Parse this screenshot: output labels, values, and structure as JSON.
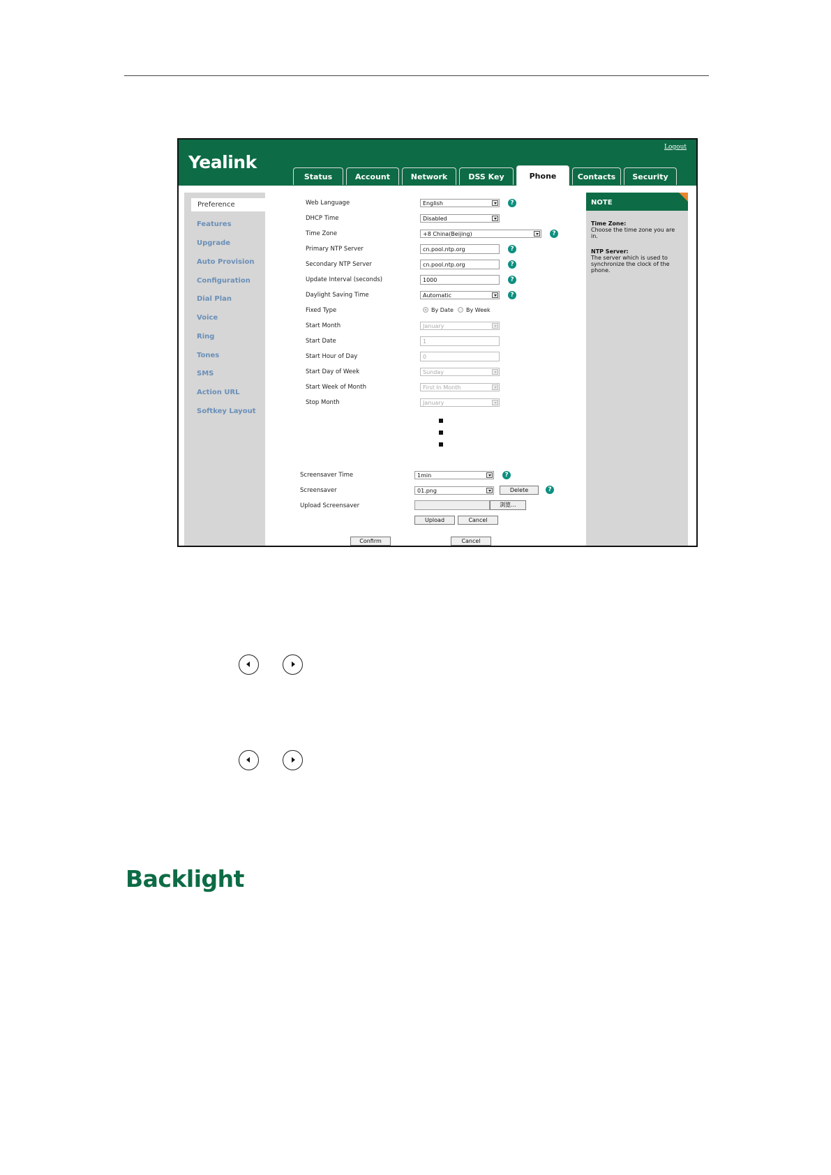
{
  "window": {
    "logo": "Yealink",
    "logout": "Logout"
  },
  "tabs": [
    {
      "label": "Status"
    },
    {
      "label": "Account"
    },
    {
      "label": "Network"
    },
    {
      "label": "DSS Key"
    },
    {
      "label": "Phone",
      "active": true
    },
    {
      "label": "Contacts"
    },
    {
      "label": "Security"
    }
  ],
  "sidebar": {
    "items": [
      {
        "label": "Preference",
        "active": true
      },
      {
        "label": "Features"
      },
      {
        "label": "Upgrade"
      },
      {
        "label": "Auto Provision"
      },
      {
        "label": "Configuration"
      },
      {
        "label": "Dial Plan"
      },
      {
        "label": "Voice"
      },
      {
        "label": "Ring"
      },
      {
        "label": "Tones"
      },
      {
        "label": "SMS"
      },
      {
        "label": "Action URL"
      },
      {
        "label": "Softkey Layout"
      }
    ]
  },
  "form": {
    "web_language": {
      "label": "Web Language",
      "value": "English"
    },
    "dhcp_time": {
      "label": "DHCP Time",
      "value": "Disabled"
    },
    "time_zone": {
      "label": "Time Zone",
      "value": "+8 China(Beijing)"
    },
    "primary_ntp": {
      "label": "Primary NTP Server",
      "value": "cn.pool.ntp.org"
    },
    "secondary_ntp": {
      "label": "Secondary NTP Server",
      "value": "cn.pool.ntp.org"
    },
    "update_interval": {
      "label": "Update Interval (seconds)",
      "value": "1000"
    },
    "daylight_saving": {
      "label": "Daylight Saving Time",
      "value": "Automatic"
    },
    "fixed_type": {
      "label": "Fixed Type",
      "option_by_date": "By Date",
      "option_by_week": "By Week"
    },
    "start_month": {
      "label": "Start Month",
      "value": "January"
    },
    "start_date": {
      "label": "Start Date",
      "value": "1"
    },
    "start_hour": {
      "label": "Start Hour of Day",
      "value": "0"
    },
    "start_day_of_week": {
      "label": "Start Day of Week",
      "value": "Sunday"
    },
    "start_week_of_month": {
      "label": "Start Week of Month",
      "value": "First In Month"
    },
    "stop_month": {
      "label": "Stop Month",
      "value": "January"
    },
    "screensaver_time": {
      "label": "Screensaver Time",
      "value": "1min"
    },
    "screensaver": {
      "label": "Screensaver",
      "value": "01.png",
      "delete_label": "Delete"
    },
    "upload_screensaver": {
      "label": "Upload Screensaver",
      "browse_label": "浏览...",
      "upload_label": "Upload",
      "cancel_label": "Cancel"
    },
    "confirm_label": "Confirm",
    "cancel_label": "Cancel"
  },
  "note": {
    "title": "NOTE",
    "time_zone_title": "Time Zone:",
    "time_zone_text": "Choose the time zone you are in.",
    "ntp_title": "NTP Server:",
    "ntp_text": "The server which is used to synchronize the clock of the phone."
  },
  "document": {
    "section_title": "Backlight"
  },
  "colors": {
    "brand_green": "#0d6b45",
    "help_teal": "#0d8f80",
    "sidebar_link": "#6a8fb8",
    "note_accent": "#e9862e"
  },
  "icons": {
    "help": "question-circle-icon",
    "dropdown": "chevron-down-icon",
    "nav_left": "left-arrow-key-icon",
    "nav_right": "right-arrow-key-icon"
  }
}
